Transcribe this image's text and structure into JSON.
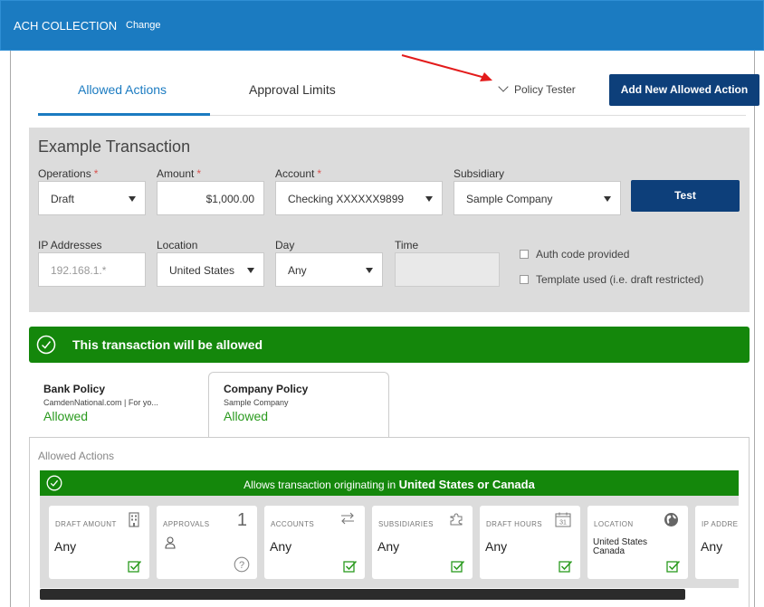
{
  "header": {
    "title": "ACH COLLECTION",
    "change_link": "Change"
  },
  "tabs": [
    {
      "label": "Allowed Actions",
      "active": true
    },
    {
      "label": "Approval Limits",
      "active": false
    }
  ],
  "policy_tester": {
    "label": "Policy Tester",
    "icon": "chevron-down-icon"
  },
  "add_button": {
    "label": "Add New Allowed Action"
  },
  "example": {
    "title": "Example Transaction",
    "operations": {
      "label": "Operations",
      "required": "*",
      "value": "Draft"
    },
    "amount": {
      "label": "Amount",
      "required": "*",
      "value": "$1,000.00"
    },
    "account": {
      "label": "Account",
      "required": "*",
      "value": "Checking XXXXXX9899"
    },
    "subsidiary": {
      "label": "Subsidiary",
      "value": "Sample Company"
    },
    "test_button": "Test",
    "ip": {
      "label": "IP Addresses",
      "placeholder": "192.168.1.*"
    },
    "location": {
      "label": "Location",
      "value": "United States"
    },
    "day": {
      "label": "Day",
      "value": "Any"
    },
    "time": {
      "label": "Time",
      "value": ""
    },
    "auth_code": {
      "label": "Auth code provided",
      "checked": false
    },
    "template_used": {
      "label": "Template used (i.e. draft restricted)",
      "checked": false
    }
  },
  "result": {
    "message": "This transaction will be allowed",
    "color": "#14870b"
  },
  "policy_tabs": [
    {
      "name": "Bank Policy",
      "sub": "CamdenNational.com | For yo...",
      "status": "Allowed"
    },
    {
      "name": "Company Policy",
      "sub": "Sample Company",
      "status": "Allowed",
      "active": true
    }
  ],
  "panel": {
    "label": "Allowed Actions",
    "rule_prefix": "Allows transaction originating in",
    "rule_bold": "United States or Canada"
  },
  "cards": [
    {
      "title": "DRAFT AMOUNT",
      "value": "Any",
      "icon": "building-icon"
    },
    {
      "title": "APPROVALS",
      "value": "",
      "count": "1",
      "icon": "user-icon",
      "foot_icon": "help-icon"
    },
    {
      "title": "ACCOUNTS",
      "value": "Any",
      "icon": "transfer-arrows-icon"
    },
    {
      "title": "SUBSIDIARIES",
      "value": "Any",
      "icon": "puzzle-icon"
    },
    {
      "title": "DRAFT HOURS",
      "value": "Any",
      "icon": "calendar-icon",
      "icon_text": "31"
    },
    {
      "title": "LOCATION",
      "value": "United States",
      "value2": "Canada",
      "icon": "globe-icon"
    },
    {
      "title": "IP ADDRESS",
      "value": "Any"
    }
  ],
  "colors": {
    "brand_blue": "#1b7bc1",
    "navy_button": "#0d3f7a",
    "success_green": "#14870b"
  }
}
